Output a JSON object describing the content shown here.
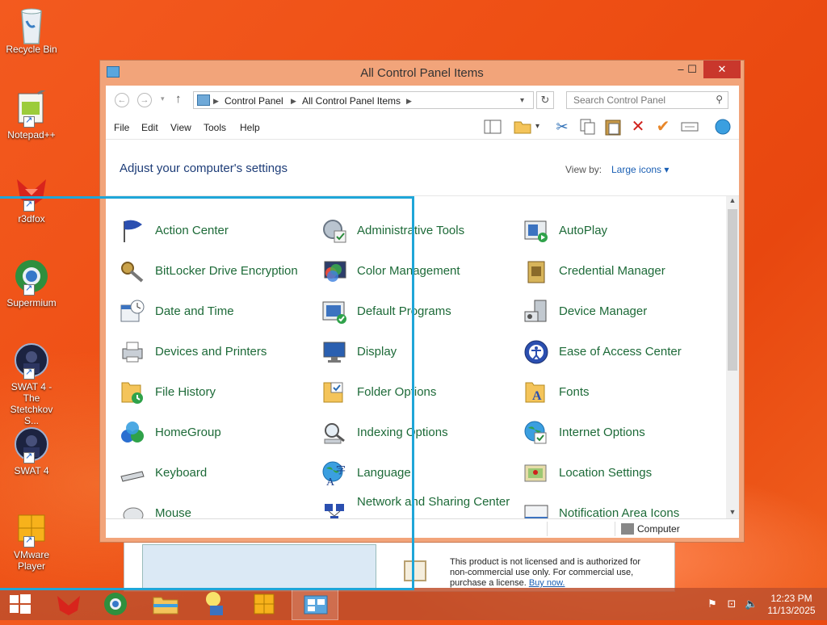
{
  "desktop": {
    "icons": [
      {
        "name": "recycle-bin",
        "label": "Recycle Bin"
      },
      {
        "name": "notepad-plus-plus",
        "label": "Notepad++"
      },
      {
        "name": "r3dfox",
        "label": "r3dfox"
      },
      {
        "name": "supermium",
        "label": "Supermium"
      },
      {
        "name": "swat4-stetchkov",
        "label": "SWAT 4 - The Stetchkov S..."
      },
      {
        "name": "swat4",
        "label": "SWAT 4"
      },
      {
        "name": "vmware-player",
        "label": "VMware Player"
      }
    ]
  },
  "window": {
    "title": "All Control Panel Items",
    "controls": {
      "minimize": "–",
      "maximize": "☐",
      "close": "✕"
    },
    "address": {
      "crumbs": [
        "Control Panel",
        "All Control Panel Items"
      ],
      "search_placeholder": "Search Control Panel"
    },
    "menu": [
      "File",
      "Edit",
      "View",
      "Tools",
      "Help"
    ],
    "heading": "Adjust your computer's settings",
    "view_by_label": "View by:",
    "view_by_value": "Large icons ▾",
    "items": [
      {
        "label": "Action Center",
        "icon": "flag-icon"
      },
      {
        "label": "Administrative Tools",
        "icon": "admin-tools-icon"
      },
      {
        "label": "AutoPlay",
        "icon": "autoplay-icon"
      },
      {
        "label": "BitLocker Drive Encryption",
        "icon": "bitlocker-key-icon"
      },
      {
        "label": "Color Management",
        "icon": "color-management-icon"
      },
      {
        "label": "Credential Manager",
        "icon": "credential-vault-icon"
      },
      {
        "label": "Date and Time",
        "icon": "calendar-clock-icon"
      },
      {
        "label": "Default Programs",
        "icon": "default-programs-icon"
      },
      {
        "label": "Device Manager",
        "icon": "device-manager-icon"
      },
      {
        "label": "Devices and Printers",
        "icon": "printer-icon"
      },
      {
        "label": "Display",
        "icon": "monitor-icon"
      },
      {
        "label": "Ease of Access Center",
        "icon": "ease-of-access-icon"
      },
      {
        "label": "File History",
        "icon": "file-history-icon"
      },
      {
        "label": "Folder Options",
        "icon": "folder-options-icon"
      },
      {
        "label": "Fonts",
        "icon": "fonts-folder-icon"
      },
      {
        "label": "HomeGroup",
        "icon": "homegroup-icon"
      },
      {
        "label": "Indexing Options",
        "icon": "indexing-magnifier-icon"
      },
      {
        "label": "Internet Options",
        "icon": "internet-globe-icon"
      },
      {
        "label": "Keyboard",
        "icon": "keyboard-icon"
      },
      {
        "label": "Language",
        "icon": "language-globe-icon"
      },
      {
        "label": "Location Settings",
        "icon": "location-icon"
      },
      {
        "label": "Mouse",
        "icon": "mouse-icon"
      },
      {
        "label": "Network and Sharing Center",
        "icon": "network-icon"
      },
      {
        "label": "Notification Area Icons",
        "icon": "notification-area-icon"
      }
    ],
    "status": "Computer"
  },
  "vm_banner": {
    "license_text": "This product is not licensed and is authorized for non-commercial use only. For commercial use, purchase a license.",
    "buy_link": "Buy now."
  },
  "taskbar": {
    "time": "12:23 PM",
    "date": "11/13/2025"
  }
}
